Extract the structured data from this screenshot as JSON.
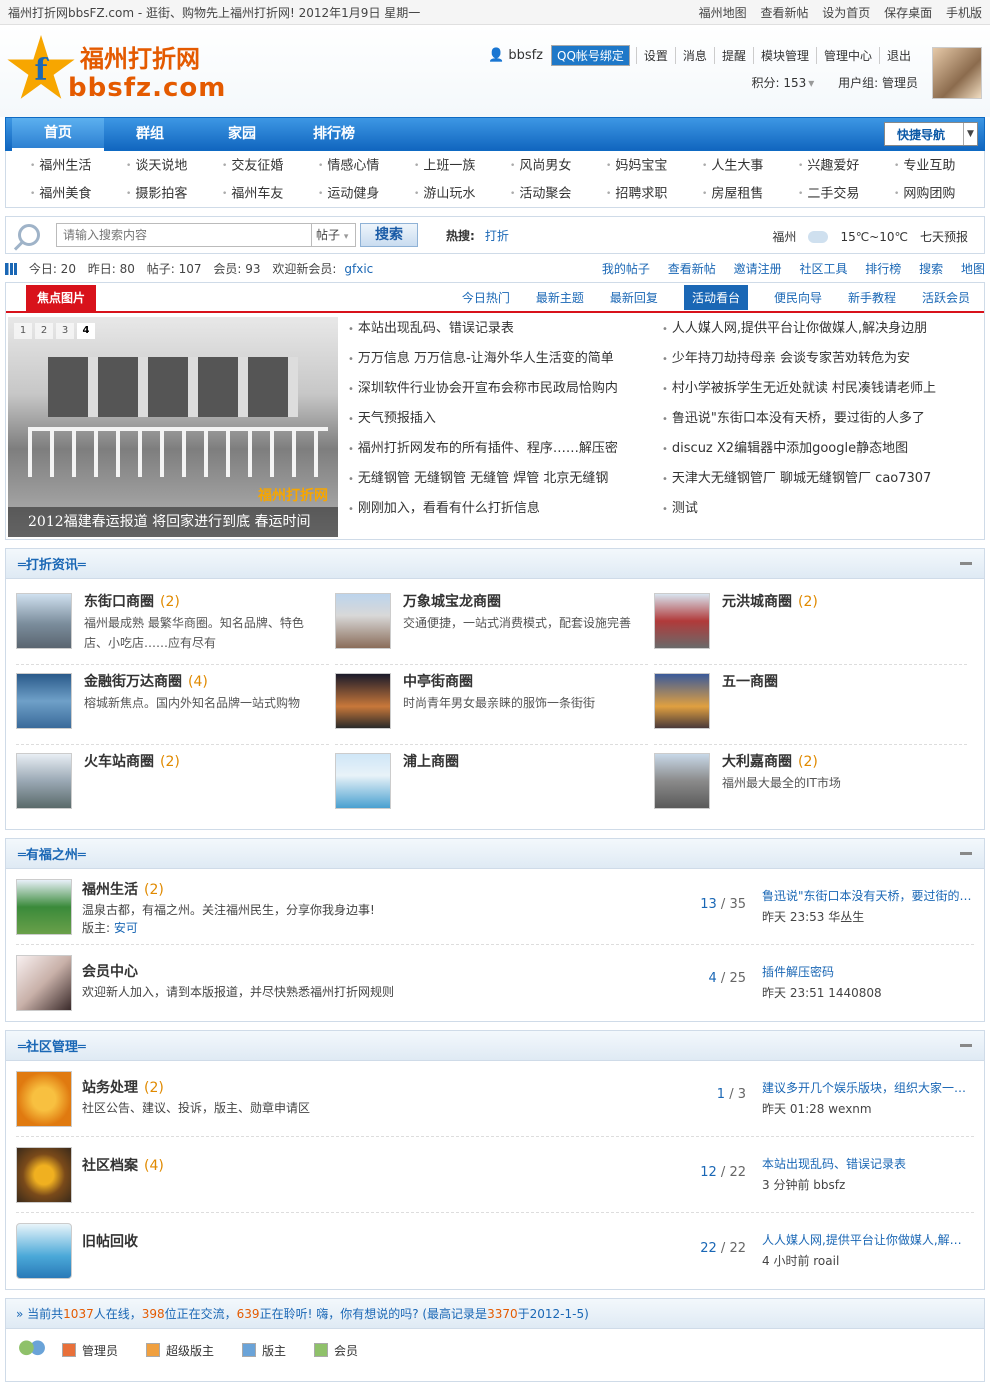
{
  "topbar": {
    "left": "福州打折网bbsFZ.com - 逛街、购物先上福州打折网! 2012年1月9日 星期一",
    "links": [
      "福州地图",
      "查看新帖",
      "设为首页",
      "保存桌面",
      "手机版"
    ]
  },
  "logo": {
    "cn": "福州打折网",
    "en": "bbsfz.com"
  },
  "user": {
    "name": "bbsfz",
    "qq_bind": "QQ帐号绑定",
    "links": [
      "设置",
      "消息",
      "提醒",
      "模块管理",
      "管理中心",
      "退出"
    ],
    "points": "积分: 153",
    "group": "用户组: 管理员"
  },
  "nav": {
    "items": [
      "首页",
      "群组",
      "家园",
      "排行榜"
    ],
    "quick": "快捷导航"
  },
  "subnav": [
    "福州生活",
    "谈天说地",
    "交友征婚",
    "情感心情",
    "上班一族",
    "风尚男女",
    "妈妈宝宝",
    "人生大事",
    "兴趣爱好",
    "专业互助",
    "福州美食",
    "摄影拍客",
    "福州车友",
    "运动健身",
    "游山玩水",
    "活动聚会",
    "招聘求职",
    "房屋租售",
    "二手交易",
    "网购团购"
  ],
  "search": {
    "placeholder": "请输入搜索内容",
    "type": "帖子",
    "button": "搜索",
    "hot_label": "热搜:",
    "hot_word": "打折",
    "city": "福州",
    "temp": "15℃~10℃",
    "forecast": "七天预报"
  },
  "stats": {
    "today": "今日: 20",
    "yesterday": "昨日: 80",
    "posts": "帖子: 107",
    "members": "会员: 93",
    "welcome": "欢迎新会员:",
    "newest": "gfxic",
    "links": [
      "我的帖子",
      "查看新帖",
      "邀请注册",
      "社区工具",
      "排行榜",
      "搜索",
      "地图"
    ]
  },
  "hotbox": {
    "title": "焦点图片",
    "tabs": [
      "今日热门",
      "最新主题",
      "最新回复",
      "活动看台",
      "便民向导",
      "新手教程",
      "活跃会员"
    ],
    "slide_nums": [
      "1",
      "2",
      "3",
      "4"
    ],
    "caption": "2012福建春运报道 将回家进行到底 春运时间",
    "watermark": "福州打折网",
    "col1": [
      "本站出现乱码、错误记录表",
      "万万信息 万万信息-让海外华人生活变的简单",
      "深圳软件行业协会开宣布会称市民政局恰购内",
      "天气预报插入",
      "福州打折网发布的所有插件、程序……解压密",
      "无缝钢管 无缝钢管 无缝管 焊管 北京无缝钢",
      "刚刚加入，看看有什么打折信息"
    ],
    "col2": [
      "人人媒人网,提供平台让你做媒人,解决身边朋",
      "少年持刀劫持母亲 会谈专家苦劝转危为安",
      "村小学被拆学生无近处就读 村民凑钱请老师上",
      "鲁迅说\"东街口本没有天桥，要过街的人多了",
      "discuz X2编辑器中添加google静态地图",
      "天津大无缝钢管厂 聊城无缝钢管厂 cao7307",
      "测试"
    ]
  },
  "shops": {
    "title": "打折资讯",
    "items": [
      {
        "name": "东街口商圈",
        "count": "(2)",
        "desc": "福州最成熟 最繁华商圈。知名品牌、特色店、小吃店……应有尽有"
      },
      {
        "name": "万象城宝龙商圈",
        "count": "",
        "desc": "交通便捷，一站式消费模式，配套设施完善"
      },
      {
        "name": "元洪城商圈",
        "count": "(2)",
        "desc": ""
      },
      {
        "name": "金融街万达商圈",
        "count": "(4)",
        "desc": "榕城新焦点。国内外知名品牌一站式购物"
      },
      {
        "name": "中亭街商圈",
        "count": "",
        "desc": "时尚青年男女最亲睐的服饰一条街街"
      },
      {
        "name": "五一商圈",
        "count": "",
        "desc": ""
      },
      {
        "name": "火车站商圈",
        "count": "(2)",
        "desc": ""
      },
      {
        "name": "浦上商圈",
        "count": "",
        "desc": ""
      },
      {
        "name": "大利嘉商圈",
        "count": "(2)",
        "desc": "福州最大最全的IT市场"
      }
    ]
  },
  "fuzhou": {
    "title": "有福之州",
    "items": [
      {
        "name": "福州生活",
        "count": "(2)",
        "desc": "温泉古都，有福之州。关注福州民生，分享你我身边事!",
        "mod_label": "版主:",
        "mod": "安可",
        "threads": "13",
        "posts": "35",
        "last_title": "鲁迅说\"东街口本没有天桥，要过街的人多了",
        "last_meta": "昨天 23:53 华丛生"
      },
      {
        "name": "会员中心",
        "count": "",
        "desc": "欢迎新人加入，请到本版报道，并尽快熟悉福州打折网规则",
        "mod_label": "",
        "mod": "",
        "threads": "4",
        "posts": "25",
        "last_title": "插件解压密码",
        "last_meta": "昨天 23:51 1440808"
      }
    ]
  },
  "manage": {
    "title": "社区管理",
    "items": [
      {
        "name": "站务处理",
        "count": "(2)",
        "desc": "社区公告、建议、投诉，版主、勋章申请区",
        "threads": "1",
        "posts": "3",
        "last_title": "建议多开几个娱乐版块，组织大家一起玩",
        "last_meta": "昨天 01:28 wexnm"
      },
      {
        "name": "社区档案",
        "count": "(4)",
        "desc": "",
        "threads": "12",
        "posts": "22",
        "last_title": "本站出现乱码、错误记录表",
        "last_meta": "3 分钟前 bbsfz"
      },
      {
        "name": "旧帖回收",
        "count": "",
        "desc": "",
        "threads": "22",
        "posts": "22",
        "last_title": "人人媒人网,提供平台让你做媒人,解决身边",
        "last_meta": "4 小时前 roail"
      }
    ]
  },
  "online": {
    "p1": "» 当前共",
    "total": "1037",
    "p2": "人在线，",
    "active": "398",
    "p3": "位正在交流，",
    "listen": "639",
    "p4": "正在聆听! 嗨，你有想说的吗? (最高记录是",
    "record": "3370",
    "p5": "于2012-1-5)",
    "legend": [
      "管理员",
      "超级版主",
      "版主",
      "会员"
    ]
  },
  "colors": {
    "accent": "#1a67b5",
    "brand": "#e45a00",
    "tab_red": "#d8121b"
  }
}
